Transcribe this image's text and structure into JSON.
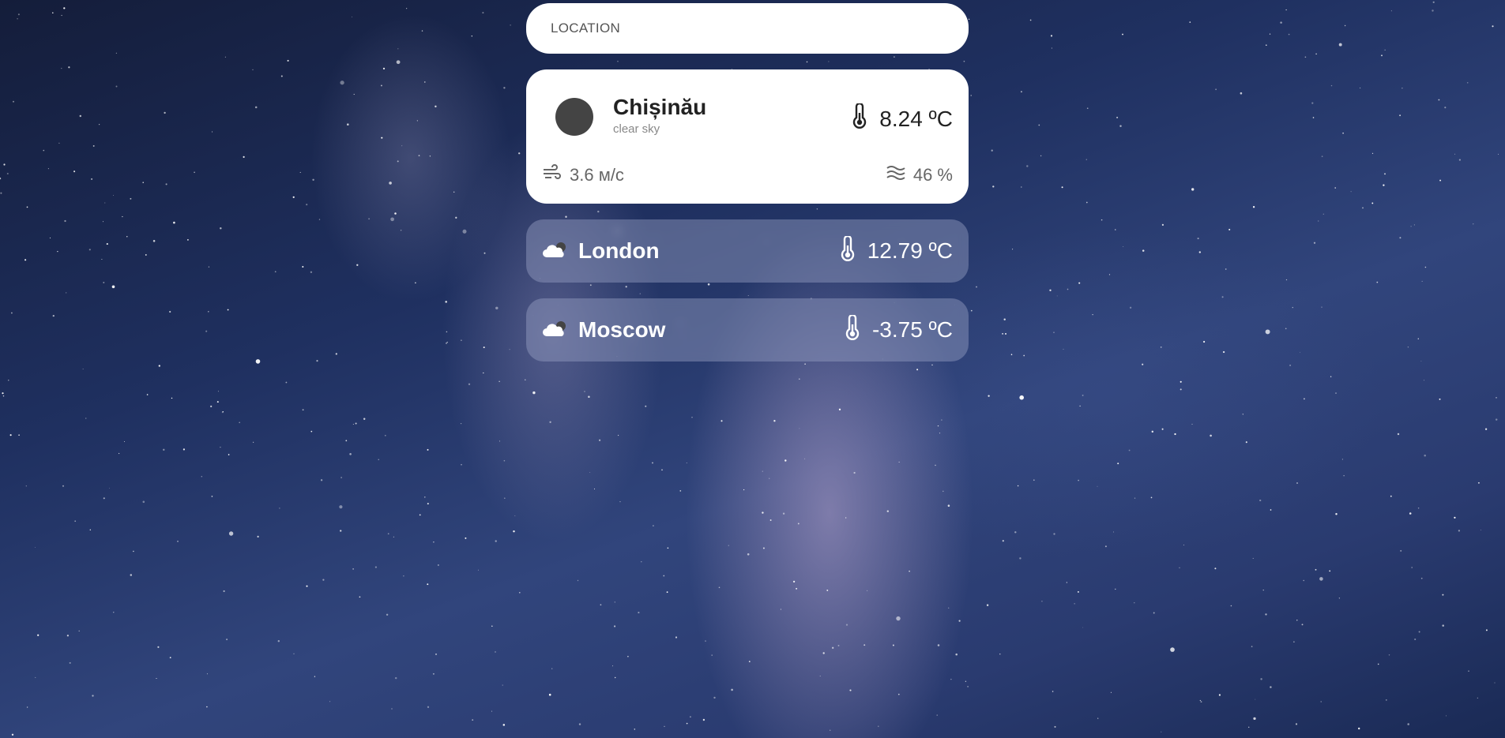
{
  "search": {
    "placeholder": "LOCATION",
    "value": ""
  },
  "current": {
    "city": "Chișinău",
    "description": "clear sky",
    "temperature": "8.24 ºC",
    "wind": "3.6 м/с",
    "humidity": "46 %",
    "icon": "sun-icon"
  },
  "saved_cities": [
    {
      "name": "London",
      "temperature": "12.79 ºC",
      "icon": "cloud-icon"
    },
    {
      "name": "Moscow",
      "temperature": "-3.75 ºC",
      "icon": "cloud-icon"
    }
  ],
  "colors": {
    "card": "#ffffff",
    "text_dark": "#222222",
    "text_muted": "#888888",
    "row_bg": "rgba(150,160,195,0.45)"
  }
}
